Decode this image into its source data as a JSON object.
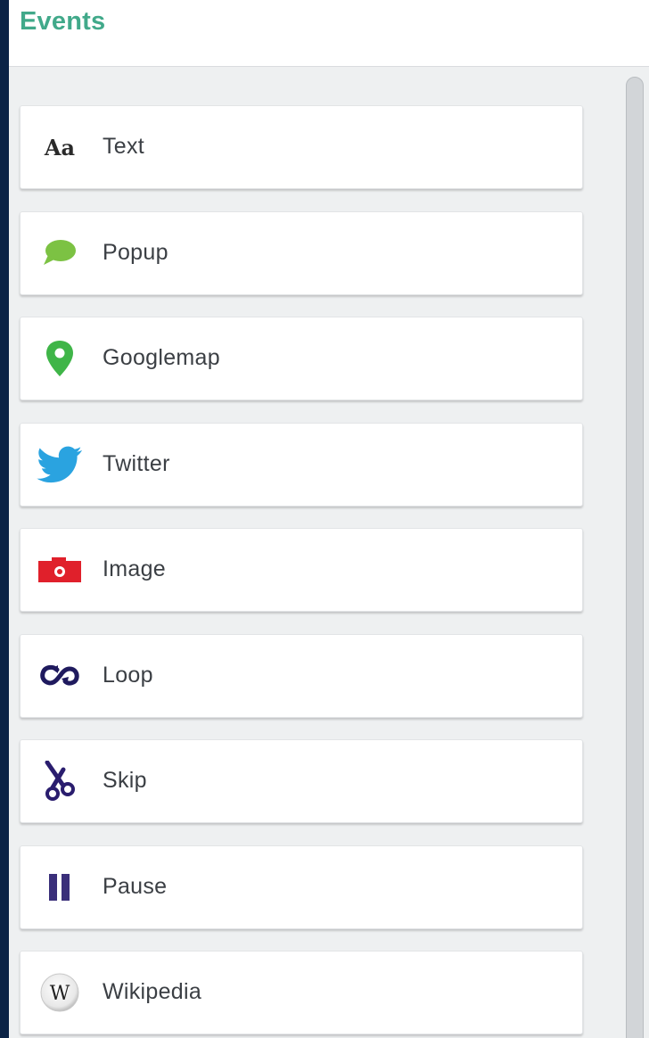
{
  "header": {
    "title": "Events"
  },
  "events": [
    {
      "label": "Text",
      "icon": "text-icon"
    },
    {
      "label": "Popup",
      "icon": "speech-bubble-icon",
      "color": "#7cc243"
    },
    {
      "label": "Googlemap",
      "icon": "map-pin-icon",
      "color": "#3fb548"
    },
    {
      "label": "Twitter",
      "icon": "twitter-bird-icon",
      "color": "#2aa3e0"
    },
    {
      "label": "Image",
      "icon": "camera-icon",
      "color": "#e0202b"
    },
    {
      "label": "Loop",
      "icon": "loop-icon",
      "color": "#1f1a5e"
    },
    {
      "label": "Skip",
      "icon": "scissors-icon",
      "color": "#2a1d6e"
    },
    {
      "label": "Pause",
      "icon": "pause-icon",
      "color": "#3a2f7a"
    },
    {
      "label": "Wikipedia",
      "icon": "wikipedia-icon"
    }
  ],
  "icon_text": {
    "text": "Aa",
    "wikipedia": "W"
  }
}
